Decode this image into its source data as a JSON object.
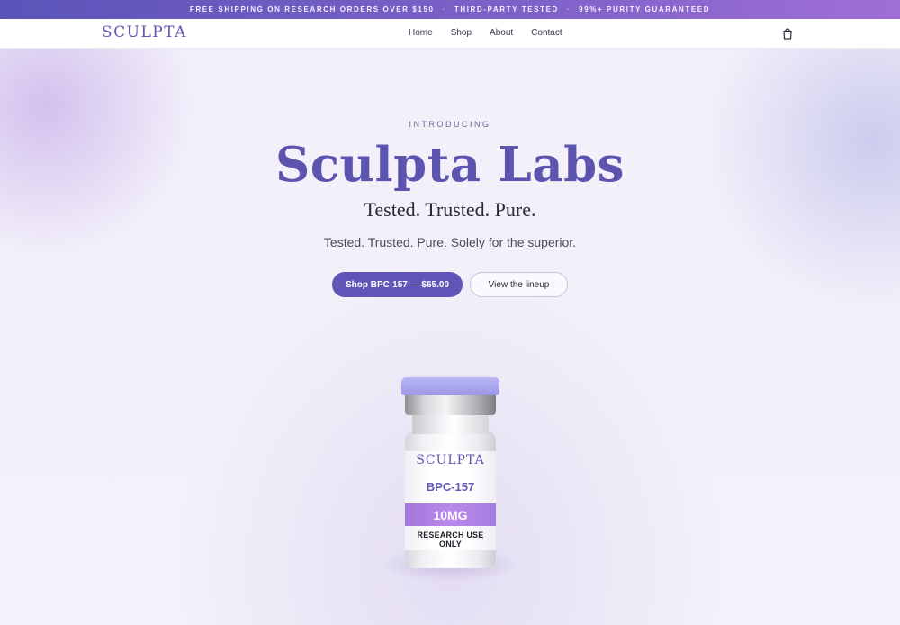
{
  "announcement": {
    "items": [
      "FREE SHIPPING ON RESEARCH ORDERS OVER $150",
      "THIRD-PARTY TESTED",
      "99%+ PURITY GUARANTEED"
    ],
    "separator": "·"
  },
  "nav": {
    "logo": "SCULPTA",
    "links": [
      "Home",
      "Shop",
      "About",
      "Contact"
    ],
    "cart_icon": "cart-icon"
  },
  "hero": {
    "eyebrow": "INTRODUCING",
    "headline": "Sculpta Labs",
    "subheadline": "Tested. Trusted. Pure.",
    "tagline": "Tested. Trusted. Pure. Solely for the superior.",
    "primary_cta": "Shop BPC-157 — $65.00",
    "secondary_cta": "View the lineup"
  },
  "product": {
    "brand": "SCULPTA",
    "name": "BPC-157",
    "dose": "10MG",
    "notice": "RESEARCH USE ONLY"
  },
  "colors": {
    "accent": "#5e55b6",
    "cap": "#b9b6f4",
    "band": "#b889ea"
  }
}
